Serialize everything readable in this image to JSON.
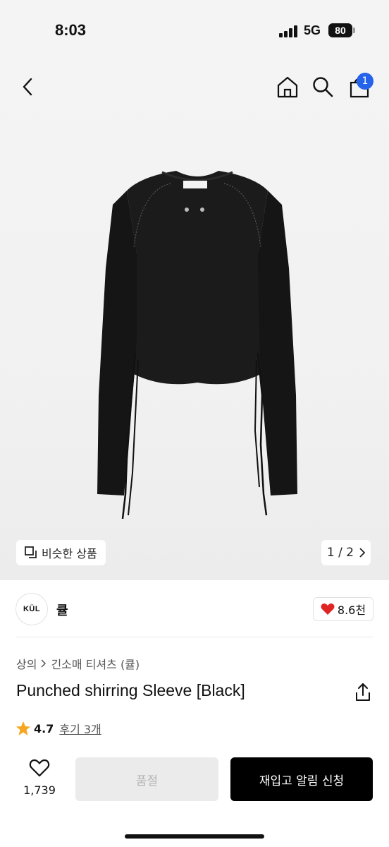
{
  "status_bar": {
    "time": "8:03",
    "network": "5G",
    "battery": "80"
  },
  "nav": {
    "cart_count": "1"
  },
  "gallery": {
    "similar_label": "비슷한 상품",
    "pager": "1 / 2"
  },
  "seller": {
    "logo_text": "KÜL",
    "name": "큘",
    "likes": "8.6천"
  },
  "breadcrumb": {
    "category": "상의",
    "subcategory": "긴소매 티셔츠 (큘)"
  },
  "product": {
    "title": "Punched shirring Sleeve [Black]",
    "rating": "4.7",
    "review_text": "후기 3개"
  },
  "bottom_bar": {
    "wish_count": "1,739",
    "soldout_label": "품절",
    "restock_label": "재입고 알림 신청"
  },
  "colors": {
    "badge": "#2563eb",
    "heart": "#e02424",
    "star": "#f5a623",
    "primary": "#000000"
  }
}
